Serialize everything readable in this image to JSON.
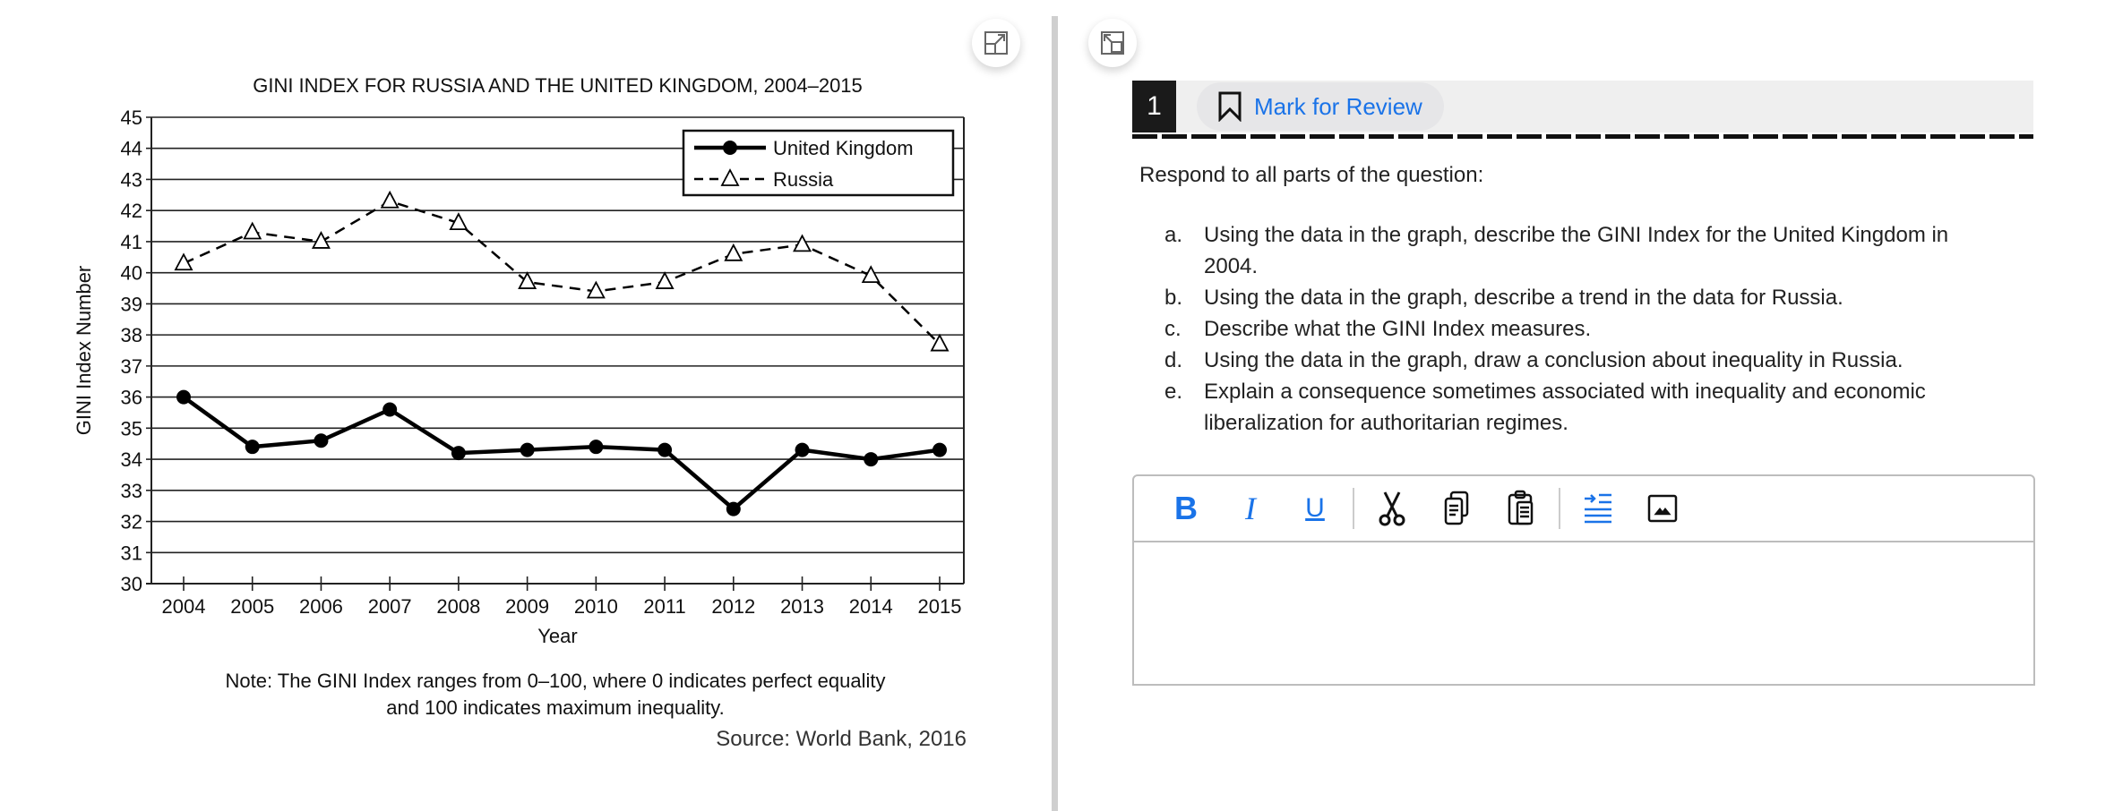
{
  "chart_data": {
    "type": "line",
    "title": "GINI INDEX FOR RUSSIA AND THE UNITED KINGDOM, 2004–2015",
    "xlabel": "Year",
    "ylabel": "GINI Index Number",
    "x": [
      "2004",
      "2005",
      "2006",
      "2007",
      "2008",
      "2009",
      "2010",
      "2011",
      "2012",
      "2013",
      "2014",
      "2015"
    ],
    "ylim": [
      30,
      45
    ],
    "yticks": [
      30,
      31,
      32,
      33,
      34,
      35,
      36,
      37,
      38,
      39,
      40,
      41,
      42,
      43,
      44,
      45
    ],
    "grid": "horizontal",
    "legend": "top-right",
    "series": [
      {
        "name": "United Kingdom",
        "marker": "filled-circle",
        "line": "solid",
        "color": "#000000",
        "values": [
          36.0,
          34.4,
          34.6,
          35.6,
          34.2,
          34.3,
          34.4,
          34.3,
          32.4,
          34.3,
          34.0,
          34.3
        ]
      },
      {
        "name": "Russia",
        "marker": "open-triangle",
        "line": "dashed",
        "color": "#000000",
        "values": [
          40.3,
          41.3,
          41.0,
          42.3,
          41.6,
          39.7,
          39.4,
          39.7,
          40.6,
          40.9,
          39.9,
          37.7
        ]
      }
    ],
    "note_line1": "Note: The GINI Index ranges from 0–100, where 0 indicates perfect equality",
    "note_line2": "and 100 indicates maximum inequality.",
    "source": "Source: World Bank, 2016"
  },
  "question": {
    "number": "1",
    "mark_label": "Mark for Review",
    "accent": "#1a73e8",
    "prompt": "Respond to all parts of the question:",
    "items": [
      {
        "marker": "a.",
        "text": "Using the data in the graph, describe the GINI Index for the United Kingdom in 2004."
      },
      {
        "marker": "b.",
        "text": "Using the data in the graph, describe a trend in the data for Russia."
      },
      {
        "marker": "c.",
        "text": "Describe what the GINI Index measures."
      },
      {
        "marker": "d.",
        "text": "Using the data in the graph, draw a conclusion about inequality in Russia."
      },
      {
        "marker": "e.",
        "text": "Explain a consequence sometimes associated with inequality and economic liberalization for authoritarian regimes."
      }
    ]
  },
  "toolbar": {
    "bold": "B",
    "italic": "I",
    "underline": "U",
    "icons": [
      "bold-icon",
      "italic-icon",
      "underline-icon",
      "cut-icon",
      "copy-icon",
      "paste-icon",
      "indent-icon",
      "image-icon"
    ]
  },
  "editor": {
    "value": ""
  }
}
